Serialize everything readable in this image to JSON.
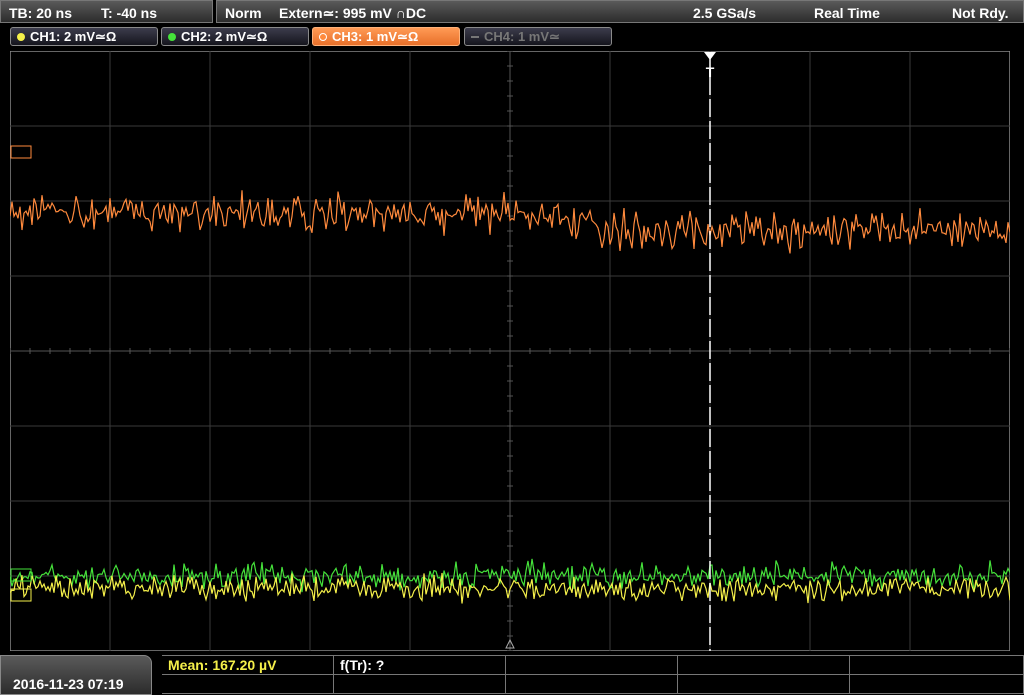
{
  "header": {
    "timebase": "TB: 20 ns",
    "trigger_time": "T: -40 ns",
    "mode": "Norm",
    "trigger_source": "Extern≃: 995 mV ∩DC",
    "sample_rate": "2.5 GSa/s",
    "acq_mode": "Real Time",
    "status": "Not Rdy."
  },
  "channels": [
    {
      "label": "CH1: 2 mV≃Ω",
      "color": "#f5f04a",
      "active": true
    },
    {
      "label": "CH2: 2 mV≃Ω",
      "color": "#45e23a",
      "active": true
    },
    {
      "label": "CH3: 1 mV≃Ω",
      "color": "#ff8a3d",
      "active": true,
      "selected": true
    },
    {
      "label": "CH4: 1 mV≃",
      "color": "#777777",
      "active": false
    }
  ],
  "trigger_marker": {
    "label": "T"
  },
  "footer": {
    "datetime": "2016-11-23 07:19",
    "measurements": [
      {
        "label": "Mean: 167.20 µV",
        "color": "#f5f04a"
      },
      {
        "label": "f(Tr): ?",
        "color": "#ffffff"
      }
    ]
  },
  "chart_data": {
    "type": "line",
    "grid": true,
    "x_divisions": 10,
    "y_divisions": 8,
    "series": [
      {
        "name": "CH3",
        "color": "#ff8a3d",
        "level_before_trigger": 0.27,
        "level_after_trigger": 0.3,
        "noise": 0.045
      },
      {
        "name": "CH2",
        "color": "#45e23a",
        "level": 0.875,
        "noise": 0.03
      },
      {
        "name": "CH1",
        "color": "#f5f04a",
        "level": 0.895,
        "noise": 0.03
      }
    ]
  }
}
